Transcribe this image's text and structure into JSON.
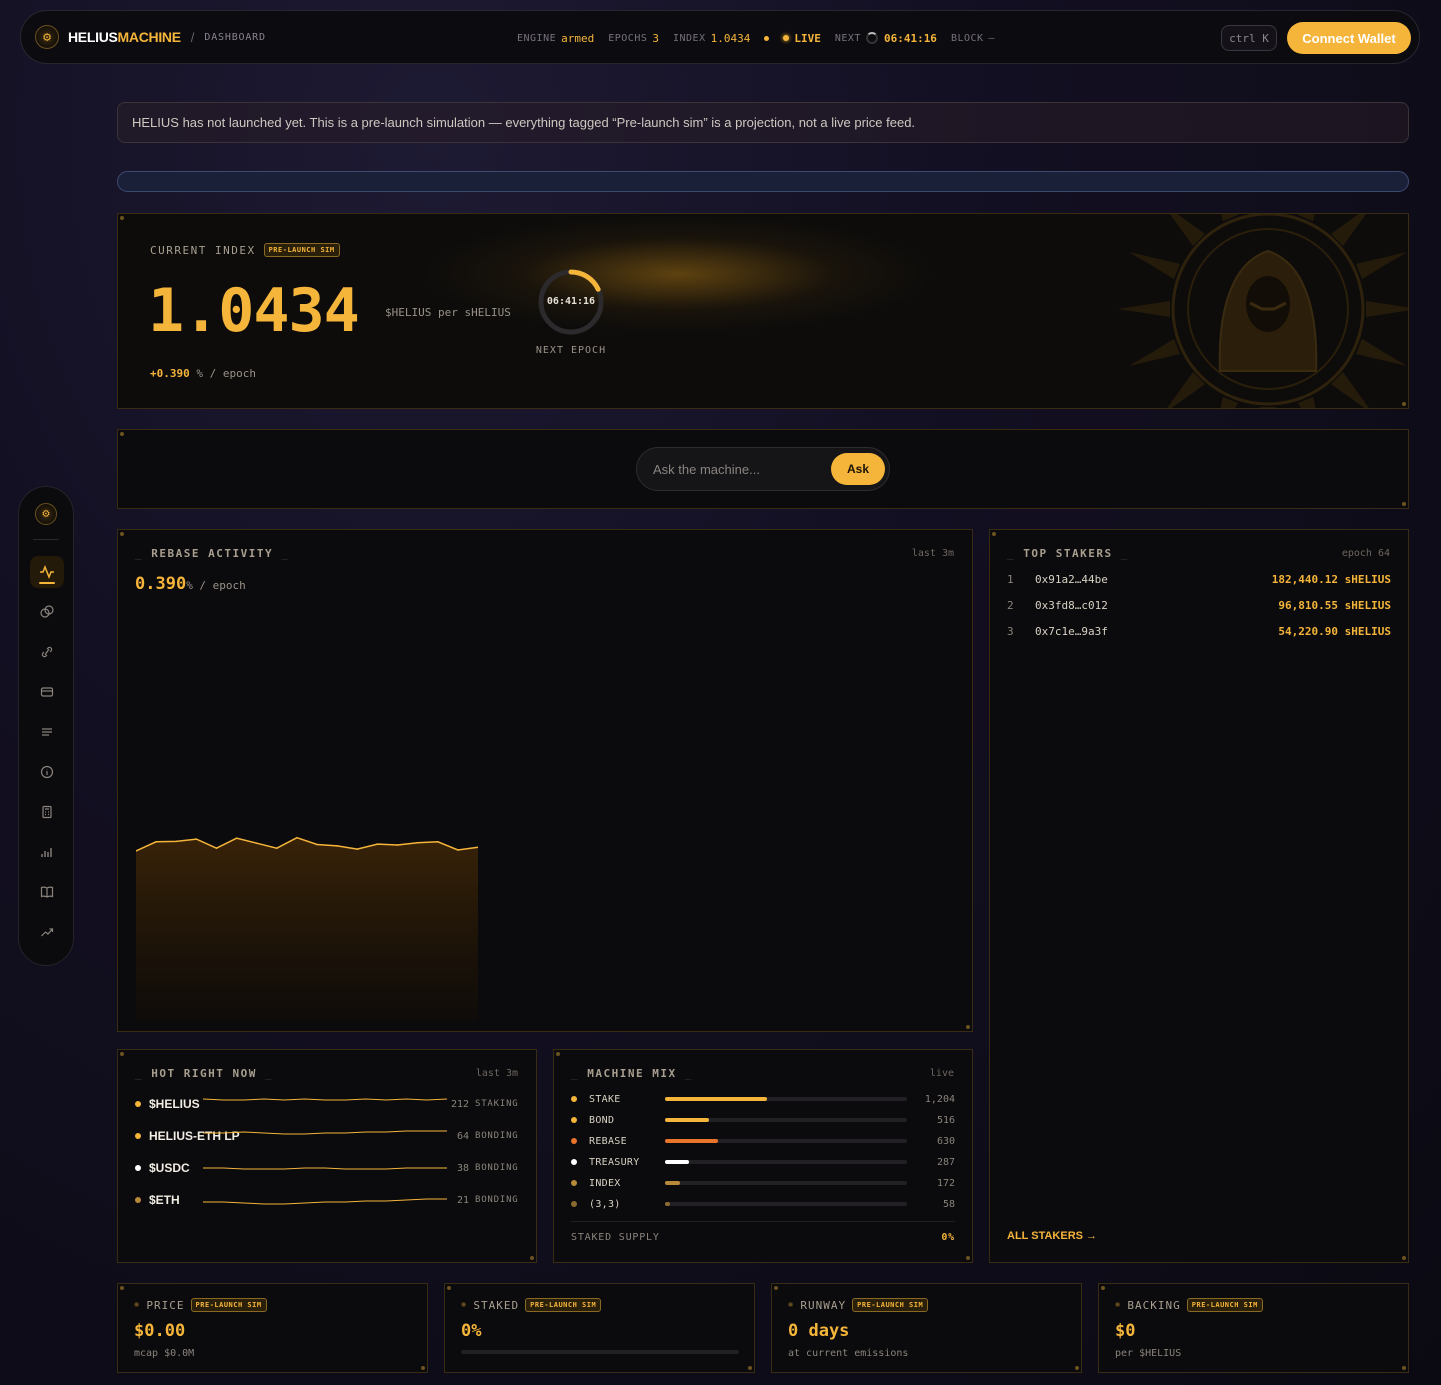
{
  "header": {
    "brand_main": "HELIUS",
    "brand_accent": "MACHINE",
    "separator": "/",
    "breadcrumb": "DASHBOARD",
    "ticker": {
      "engine_label": "ENGINE",
      "engine_value": "armed",
      "epochs_label": "EPOCHS",
      "epochs_value": "3",
      "index_label": "INDEX",
      "index_value": "1.0434",
      "live_label": "LIVE",
      "next_label": "NEXT",
      "next_value": "06:41:16",
      "block_label": "BLOCK",
      "block_value": "—"
    },
    "shortcut": "ctrl K",
    "connect_label": "Connect Wallet"
  },
  "banner": {
    "text": "HELIUS has not launched yet. This is a pre-launch simulation — everything tagged “Pre-launch sim” is a projection, not a live price feed."
  },
  "hero": {
    "label": "CURRENT INDEX",
    "tag": "PRE-LAUNCH SIM",
    "value": "1.0434",
    "unit": "$HELIUS per sHELIUS",
    "delta_value": "+0.390",
    "delta_suffix": "% / epoch",
    "countdown": "06:41:16",
    "countdown_label": "NEXT EPOCH",
    "countdown_progress": 0.18
  },
  "ask": {
    "placeholder": "Ask the machine...",
    "button": "Ask"
  },
  "sidebar": {
    "items": [
      {
        "icon": "activity-icon",
        "active": true
      },
      {
        "icon": "coins-icon"
      },
      {
        "icon": "bond-icon"
      },
      {
        "icon": "wallet-icon"
      },
      {
        "icon": "list-icon"
      },
      {
        "icon": "info-icon"
      },
      {
        "icon": "calculator-icon"
      },
      {
        "icon": "bar-chart-icon"
      },
      {
        "icon": "book-icon"
      },
      {
        "icon": "trending-up-icon"
      }
    ]
  },
  "rebase": {
    "title": "REBASE ACTIVITY",
    "meta": "last 3m",
    "value": "0.390",
    "value_suffix": "% / epoch"
  },
  "chart_data": {
    "type": "area",
    "title": "REBASE ACTIVITY",
    "xlabel": "",
    "ylabel": "",
    "values": [
      0.372,
      0.392,
      0.393,
      0.398,
      0.378,
      0.4,
      0.389,
      0.378,
      0.401,
      0.386,
      0.383,
      0.376,
      0.387,
      0.385,
      0.39,
      0.392,
      0.374,
      0.38
    ],
    "ylim": [
      0.0,
      0.55
    ],
    "grid": false,
    "color": "#f5b53a"
  },
  "stakers": {
    "title": "TOP STAKERS",
    "meta": "epoch 64",
    "rows": [
      {
        "rank": "1",
        "address": "0x91a2…44be",
        "amount": "182,440.12 sHELIUS"
      },
      {
        "rank": "2",
        "address": "0x3fd8…c012",
        "amount": "96,810.55 sHELIUS"
      },
      {
        "rank": "3",
        "address": "0x7c1e…9a3f",
        "amount": "54,220.90 sHELIUS"
      }
    ],
    "all_link": "ALL STAKERS →"
  },
  "hot": {
    "title": "HOT RIGHT NOW",
    "meta": "last 3m",
    "rows": [
      {
        "name": "$HELIUS",
        "count": "212",
        "tag": "STAKING",
        "color": "#f5b53a",
        "spark": [
          4,
          5,
          5,
          4,
          5,
          4,
          5,
          5,
          4,
          5,
          4,
          5,
          4
        ]
      },
      {
        "name": "HELIUS-ETH LP",
        "count": "64",
        "tag": "BONDING",
        "color": "#f5b53a",
        "spark": [
          6,
          6,
          5,
          6,
          7,
          7,
          6,
          6,
          5,
          5,
          4,
          4,
          4
        ]
      },
      {
        "name": "$USDC",
        "count": "38",
        "tag": "BONDING",
        "color": "#ffffff",
        "spark": [
          9,
          9,
          10,
          10,
          10,
          9,
          9,
          10,
          10,
          10,
          9,
          9,
          9
        ]
      },
      {
        "name": "$ETH",
        "count": "21",
        "tag": "BONDING",
        "color": "#b78a3a",
        "spark": [
          11,
          11,
          12,
          13,
          13,
          12,
          11,
          11,
          10,
          10,
          9,
          8,
          8
        ]
      }
    ]
  },
  "mix": {
    "title": "MACHINE MIX",
    "meta": "live",
    "rows": [
      {
        "name": "STAKE",
        "value": "1,204",
        "fraction": 0.42,
        "color": "#f5b53a"
      },
      {
        "name": "BOND",
        "value": "516",
        "fraction": 0.18,
        "color": "#f5b53a"
      },
      {
        "name": "REBASE",
        "value": "630",
        "fraction": 0.22,
        "color": "#e8752a"
      },
      {
        "name": "TREASURY",
        "value": "287",
        "fraction": 0.1,
        "color": "#ffffff"
      },
      {
        "name": "INDEX",
        "value": "172",
        "fraction": 0.06,
        "color": "#b78a3a"
      },
      {
        "name": "(3,3)",
        "value": "58",
        "fraction": 0.02,
        "color": "#8a6a30"
      }
    ],
    "footer_label": "STAKED SUPPLY",
    "footer_value": "0%"
  },
  "stats": [
    {
      "label": "PRICE",
      "tag": "PRE-LAUNCH SIM",
      "value": "$0.00",
      "sub": "mcap $0.0M"
    },
    {
      "label": "STAKED",
      "tag": "PRE-LAUNCH SIM",
      "value": "0%",
      "sub": ""
    },
    {
      "label": "RUNWAY",
      "tag": "PRE-LAUNCH SIM",
      "value": "0 days",
      "sub": "at current emissions"
    },
    {
      "label": "BACKING",
      "tag": "PRE-LAUNCH SIM",
      "value": "$0",
      "sub": "per $HELIUS"
    }
  ]
}
